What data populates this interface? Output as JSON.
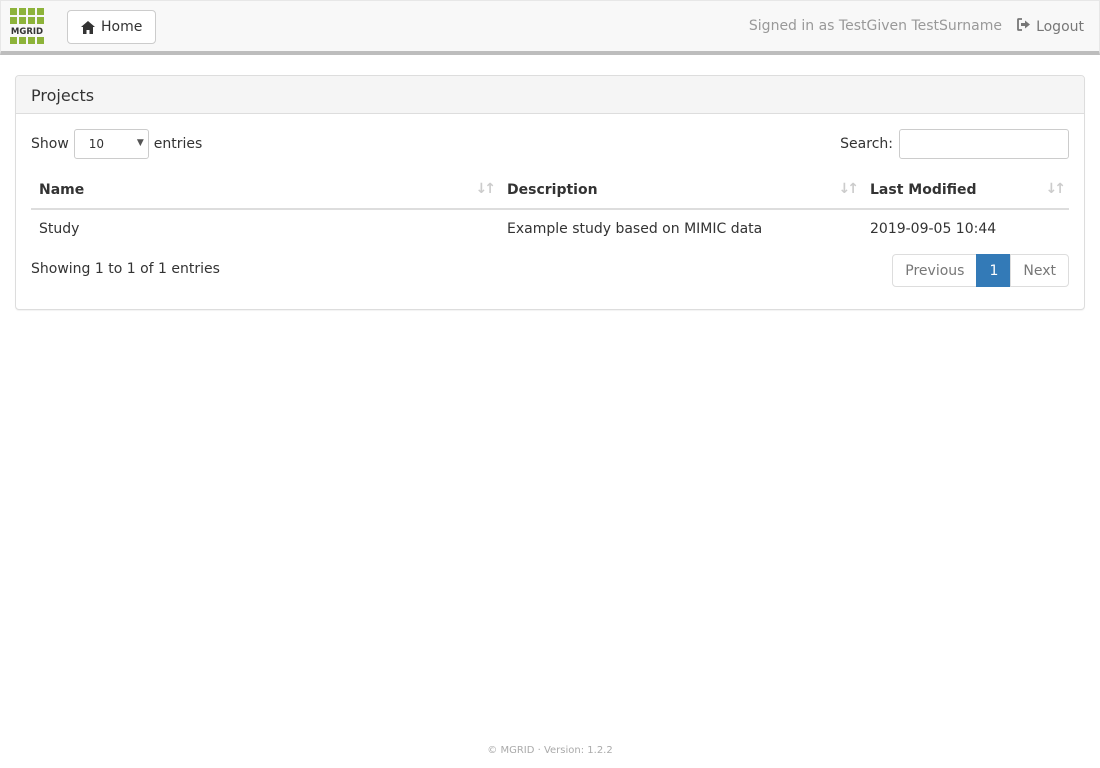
{
  "navbar": {
    "logo_text": "MGRID",
    "logo_icon": "mgrid-logo-icon",
    "home_icon": "home-icon",
    "home_label": "Home",
    "signed_in_text": "Signed in as TestGiven TestSurname",
    "logout_icon": "logout-icon",
    "logout_label": "Logout"
  },
  "panel": {
    "title": "Projects",
    "length": {
      "prefix": "Show",
      "value": "10",
      "suffix": "entries"
    },
    "search": {
      "label": "Search:",
      "value": "",
      "placeholder": ""
    },
    "table": {
      "columns": [
        "Name",
        "Description",
        "Last Modified"
      ],
      "rows": [
        [
          "Study",
          "Example study based on MIMIC data",
          "2019-09-05 10:44"
        ]
      ]
    },
    "info": "Showing 1 to 1 of 1 entries",
    "pagination": {
      "previous": "Previous",
      "current": "1",
      "next": "Next"
    }
  },
  "footer": {
    "text": "© MGRID · Version: 1.2.2"
  },
  "colors": {
    "brand_green": "#8db33a",
    "primary_blue": "#337ab7"
  }
}
